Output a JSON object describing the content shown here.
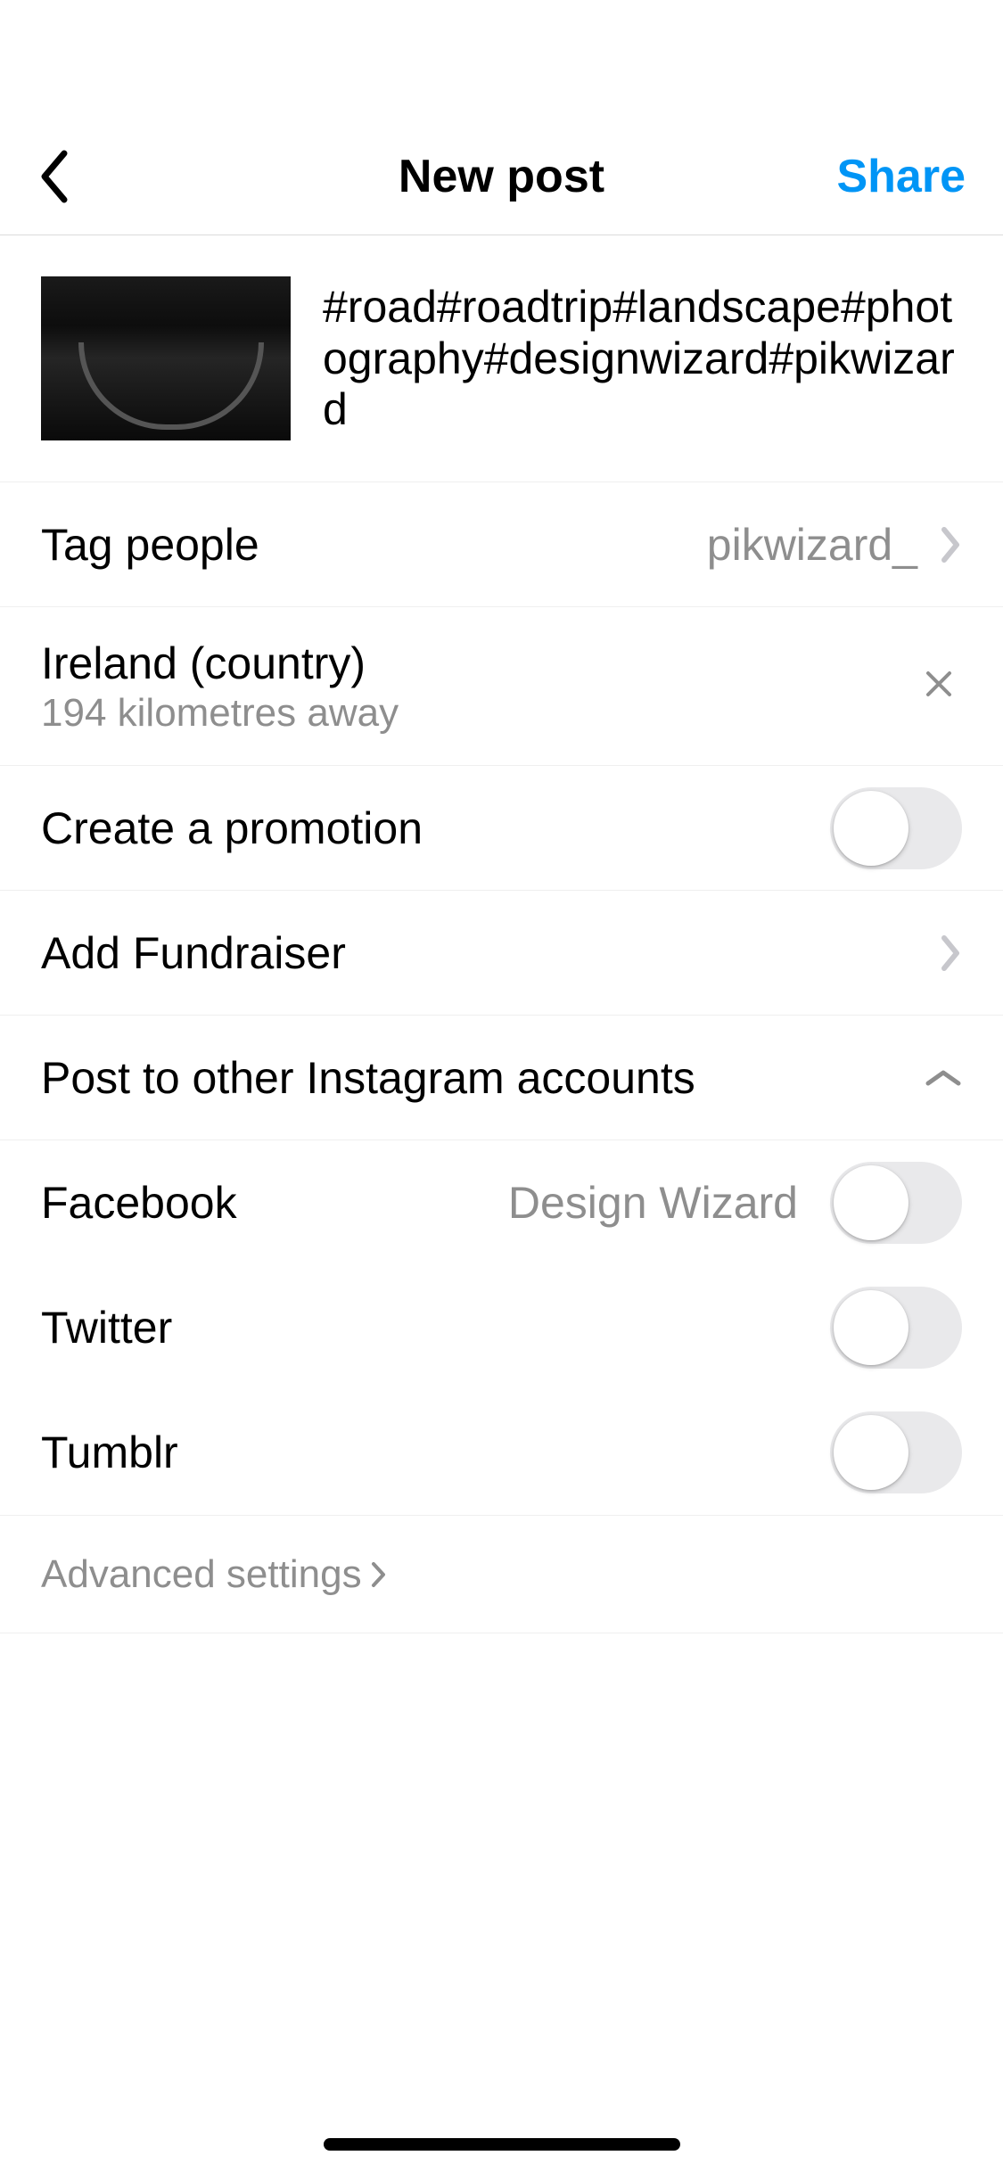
{
  "header": {
    "title": "New post",
    "share_label": "Share"
  },
  "caption": "#road#roadtrip#landscape#photography#designwizard#pikwizard",
  "tag_people": {
    "label": "Tag people",
    "value": "pikwizard_"
  },
  "location": {
    "name": "Ireland (country)",
    "distance": "194 kilometres away"
  },
  "promotion": {
    "label": "Create a promotion",
    "enabled": false
  },
  "fundraiser": {
    "label": "Add Fundraiser"
  },
  "other_accounts": {
    "label": "Post to other Instagram accounts"
  },
  "social": {
    "facebook": {
      "label": "Facebook",
      "account": "Design Wizard",
      "enabled": false
    },
    "twitter": {
      "label": "Twitter",
      "enabled": false
    },
    "tumblr": {
      "label": "Tumblr",
      "enabled": false
    }
  },
  "advanced": {
    "label": "Advanced settings"
  }
}
